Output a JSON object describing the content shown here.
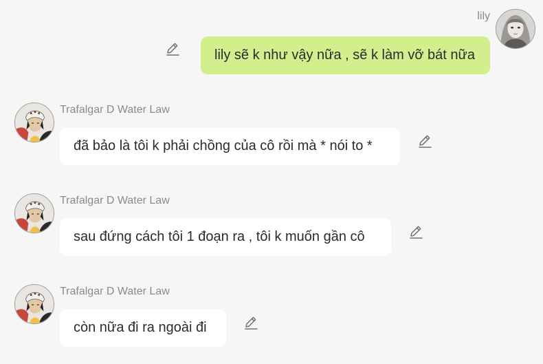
{
  "messages": [
    {
      "role": "user",
      "name": "lily",
      "text": "lily sẽ k như vậy nữa , sẽ k làm vỡ bát nữa",
      "edit_icon": "pencil-edit-icon"
    },
    {
      "role": "bot",
      "name": "Trafalgar D Water Law",
      "text": "đã bảo là tôi k phải chồng của cô rồi mà * nói to *",
      "edit_icon": "pencil-edit-icon"
    },
    {
      "role": "bot",
      "name": "Trafalgar D Water Law",
      "text": "sau đứng cách tôi 1 đoạn ra , tôi k muốn gần cô",
      "edit_icon": "pencil-edit-icon"
    },
    {
      "role": "bot",
      "name": "Trafalgar D Water Law",
      "text": "còn nữa đi ra ngoài đi",
      "edit_icon": "pencil-edit-icon"
    }
  ],
  "colors": {
    "background": "#f6f6f6",
    "user_bubble": "#d3ee8d",
    "bot_bubble": "#ffffff",
    "name_text": "#8a8a8a",
    "message_text": "#2b2b2b"
  }
}
